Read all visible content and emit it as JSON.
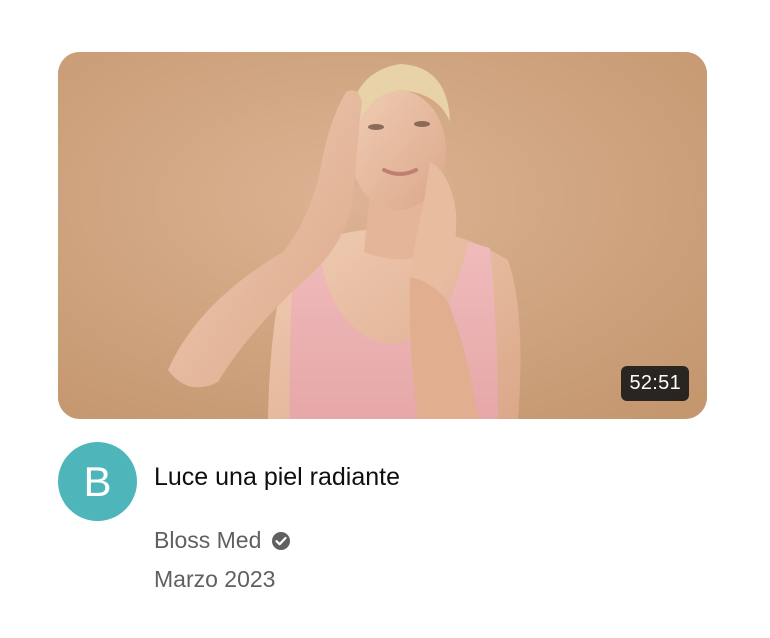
{
  "video": {
    "duration": "52:51",
    "title": "Luce una piel radiante",
    "thumbnail_subject": "woman-touching-face-pink-top"
  },
  "channel": {
    "avatar_letter": "B",
    "avatar_color": "#4eb6bb",
    "name": "Bloss Med",
    "verified_icon": "verified-check-icon"
  },
  "meta": {
    "date": "Marzo 2023"
  },
  "colors": {
    "thumbnail_background": "#cfa582",
    "title_text": "#0f0f0f",
    "secondary_text": "#606060"
  }
}
